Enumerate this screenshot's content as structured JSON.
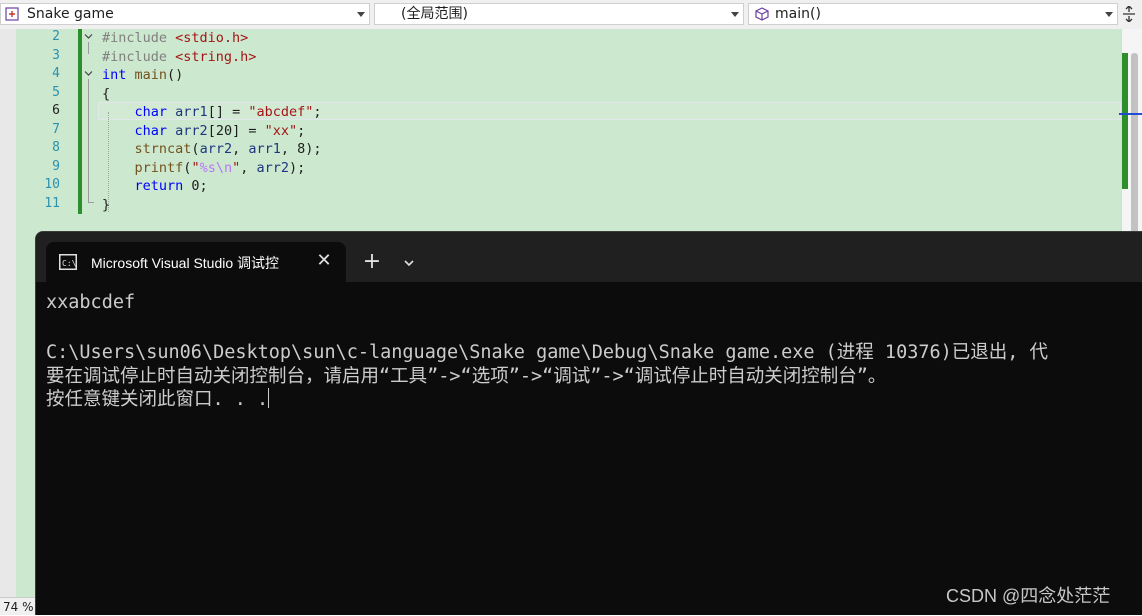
{
  "navbar": {
    "project": "Snake game",
    "scope": "(全局范围)",
    "member": "main()"
  },
  "editor": {
    "lines": [
      {
        "num": "2",
        "text": "#include <stdio.h>"
      },
      {
        "num": "3",
        "text": "#include <string.h>"
      },
      {
        "num": "4",
        "text": "int main()"
      },
      {
        "num": "5",
        "text": "{"
      },
      {
        "num": "6",
        "text": "    char arr1[] = \"abcdef\";"
      },
      {
        "num": "7",
        "text": "    char arr2[20] = \"xx\";"
      },
      {
        "num": "8",
        "text": "    strncat(arr2, arr1, 8);"
      },
      {
        "num": "9",
        "text": "    printf(\"%s\\n\", arr2);"
      },
      {
        "num": "10",
        "text": "    return 0;"
      },
      {
        "num": "11",
        "text": "}"
      }
    ],
    "current_line": "6",
    "zoom": "74 %"
  },
  "console": {
    "tab_title": "Microsoft Visual Studio 调试控",
    "output": [
      "xxabcdef",
      "",
      "C:\\Users\\sun06\\Desktop\\sun\\c-language\\Snake game\\Debug\\Snake game.exe (进程 10376)已退出, 代",
      "要在调试停止时自动关闭控制台，请启用“工具”->“选项”->“调试”->“调试停止时自动关闭控制台”。",
      "按任意键关闭此窗口. . ."
    ]
  },
  "watermark": "CSDN @四念处茫茫",
  "colors": {
    "editor_bg": "#cce8cf",
    "console_bg": "#0c0c0c",
    "keyword": "#0000ff",
    "string": "#a31515",
    "change_bar": "#2c8f2c"
  }
}
